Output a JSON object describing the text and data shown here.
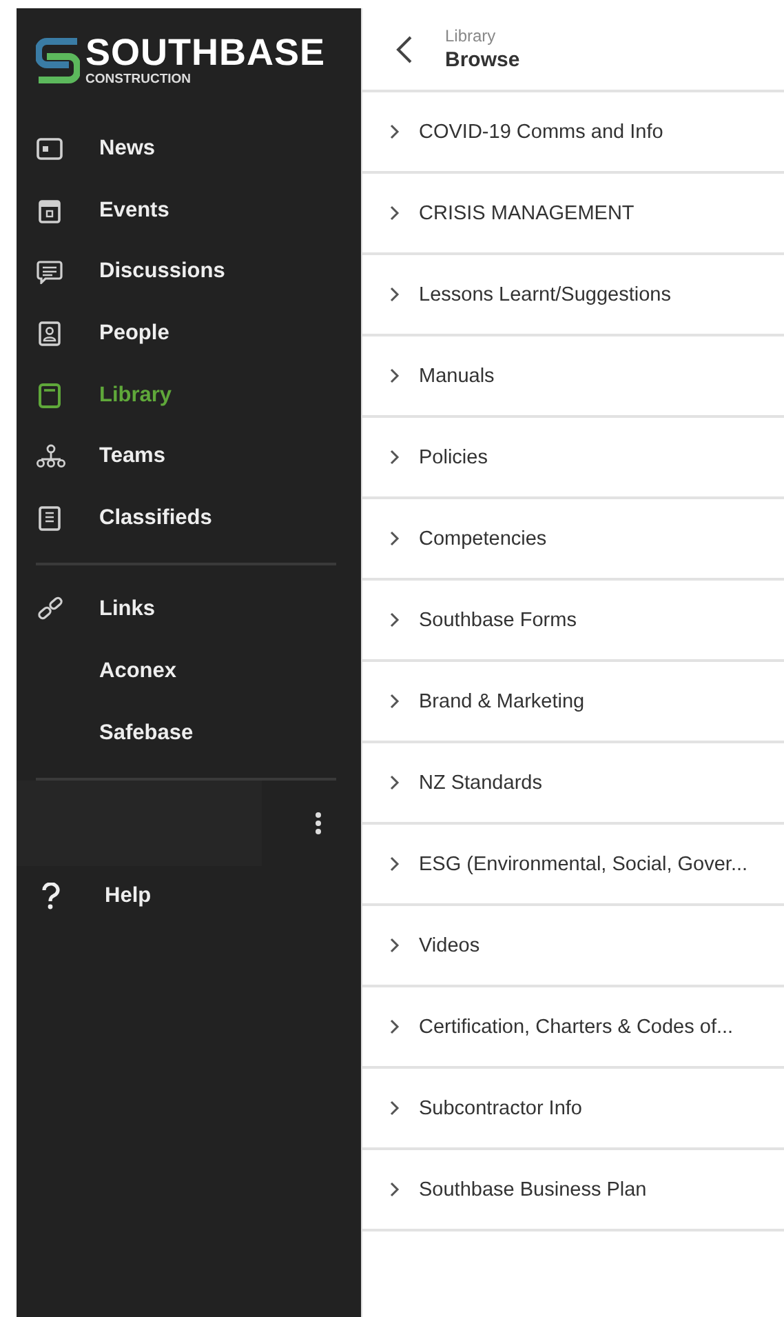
{
  "brand": {
    "name": "SOUTHBASE",
    "subtitle": "CONSTRUCTION"
  },
  "nav": [
    {
      "label": "News",
      "selected": false
    },
    {
      "label": "Events",
      "selected": false
    },
    {
      "label": "Discussions",
      "selected": false
    },
    {
      "label": "People",
      "selected": false
    },
    {
      "label": "Library",
      "selected": true
    },
    {
      "label": "Teams",
      "selected": false
    },
    {
      "label": "Classifieds",
      "selected": false
    }
  ],
  "links": {
    "label": "Links",
    "items": [
      "Aconex",
      "Safebase"
    ]
  },
  "help": "Help",
  "header": {
    "breadcrumb": "Library",
    "title": "Browse"
  },
  "folders": [
    "COVID-19 Comms and Info",
    "CRISIS MANAGEMENT",
    "Lessons Learnt/Suggestions",
    "Manuals",
    "Policies",
    "Competencies",
    "Southbase Forms",
    "Brand & Marketing",
    "NZ Standards",
    "ESG (Environmental, Social, Gover...",
    "Videos",
    "Certification, Charters & Codes of...",
    "Subcontractor Info",
    "Southbase Business Plan"
  ]
}
